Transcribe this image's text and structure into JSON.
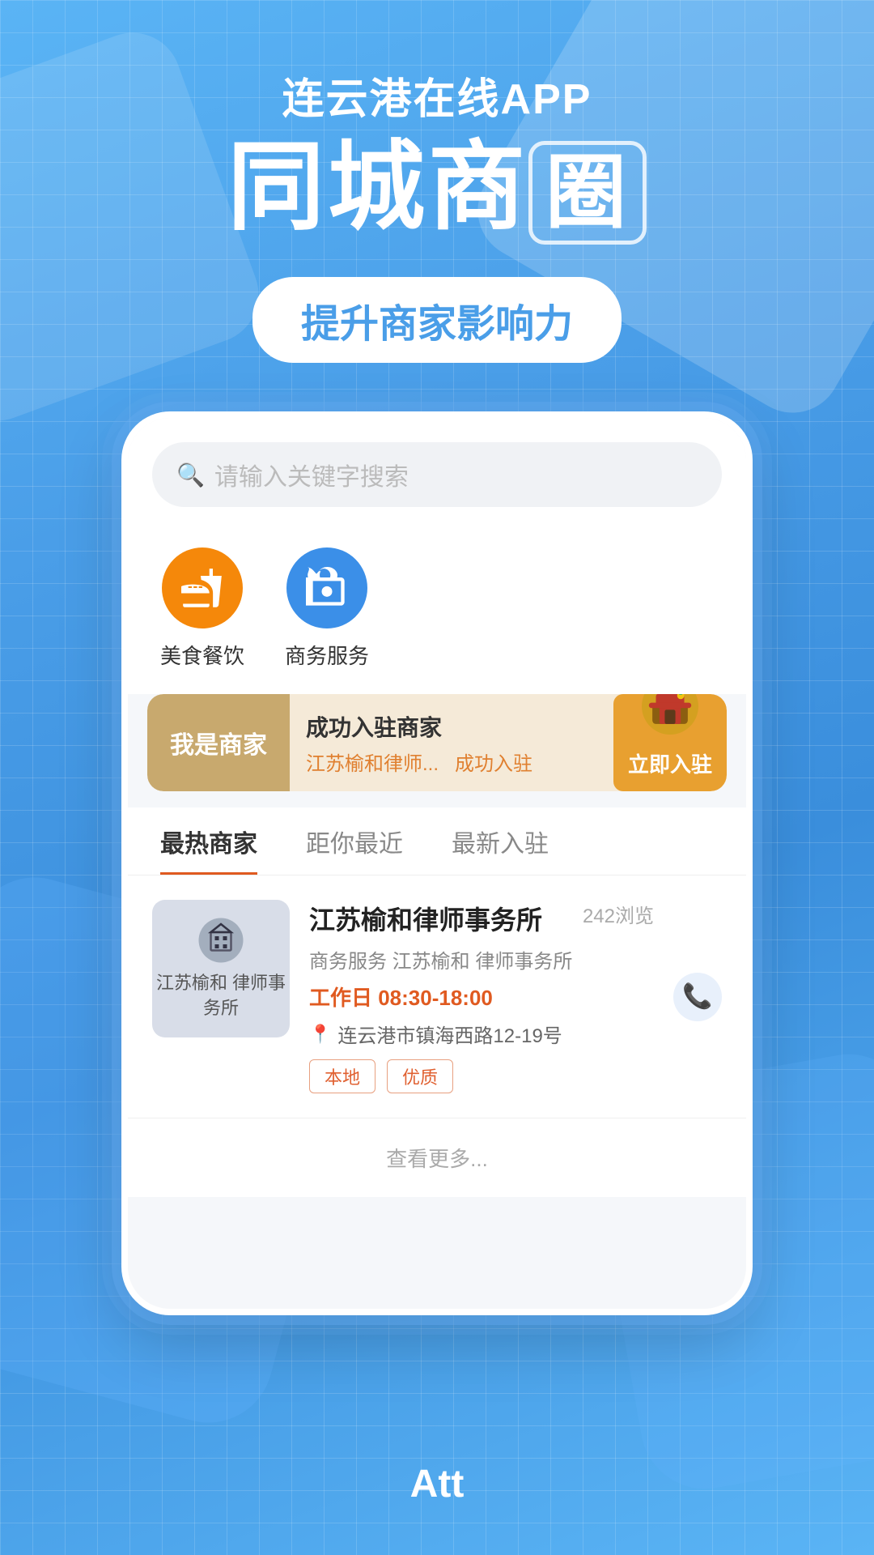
{
  "header": {
    "subtitle": "连云港在线APP",
    "main_title_part1": "同城商",
    "main_title_boxed": "圈",
    "tagline": "提升商家影响力"
  },
  "search": {
    "placeholder": "请输入关键字搜索"
  },
  "categories": [
    {
      "label": "美食餐饮",
      "type": "food"
    },
    {
      "label": "商务服务",
      "type": "business"
    }
  ],
  "merchant_banner": {
    "tag": "我是商家",
    "title": "成功入驻商家",
    "sub_text1": "江苏榆和律师...",
    "sub_text2": "成功入驻",
    "btn_label": "立即入驻"
  },
  "tabs": [
    {
      "label": "最热商家",
      "active": true
    },
    {
      "label": "距你最近",
      "active": false
    },
    {
      "label": "最新入驻",
      "active": false
    }
  ],
  "business_card": {
    "logo_text": "江苏榆和\n律师事务所",
    "name": "江苏榆和律师事务所",
    "view_count": "242浏览",
    "desc": "商务服务 江苏榆和 律师事务所",
    "hours": "工作日 08:30-18:00",
    "address": "连云港市镇海西路12-19号",
    "tags": [
      "本地",
      "优质"
    ]
  },
  "see_more": "查看更多...",
  "bottom": {
    "att_text": "Att"
  }
}
